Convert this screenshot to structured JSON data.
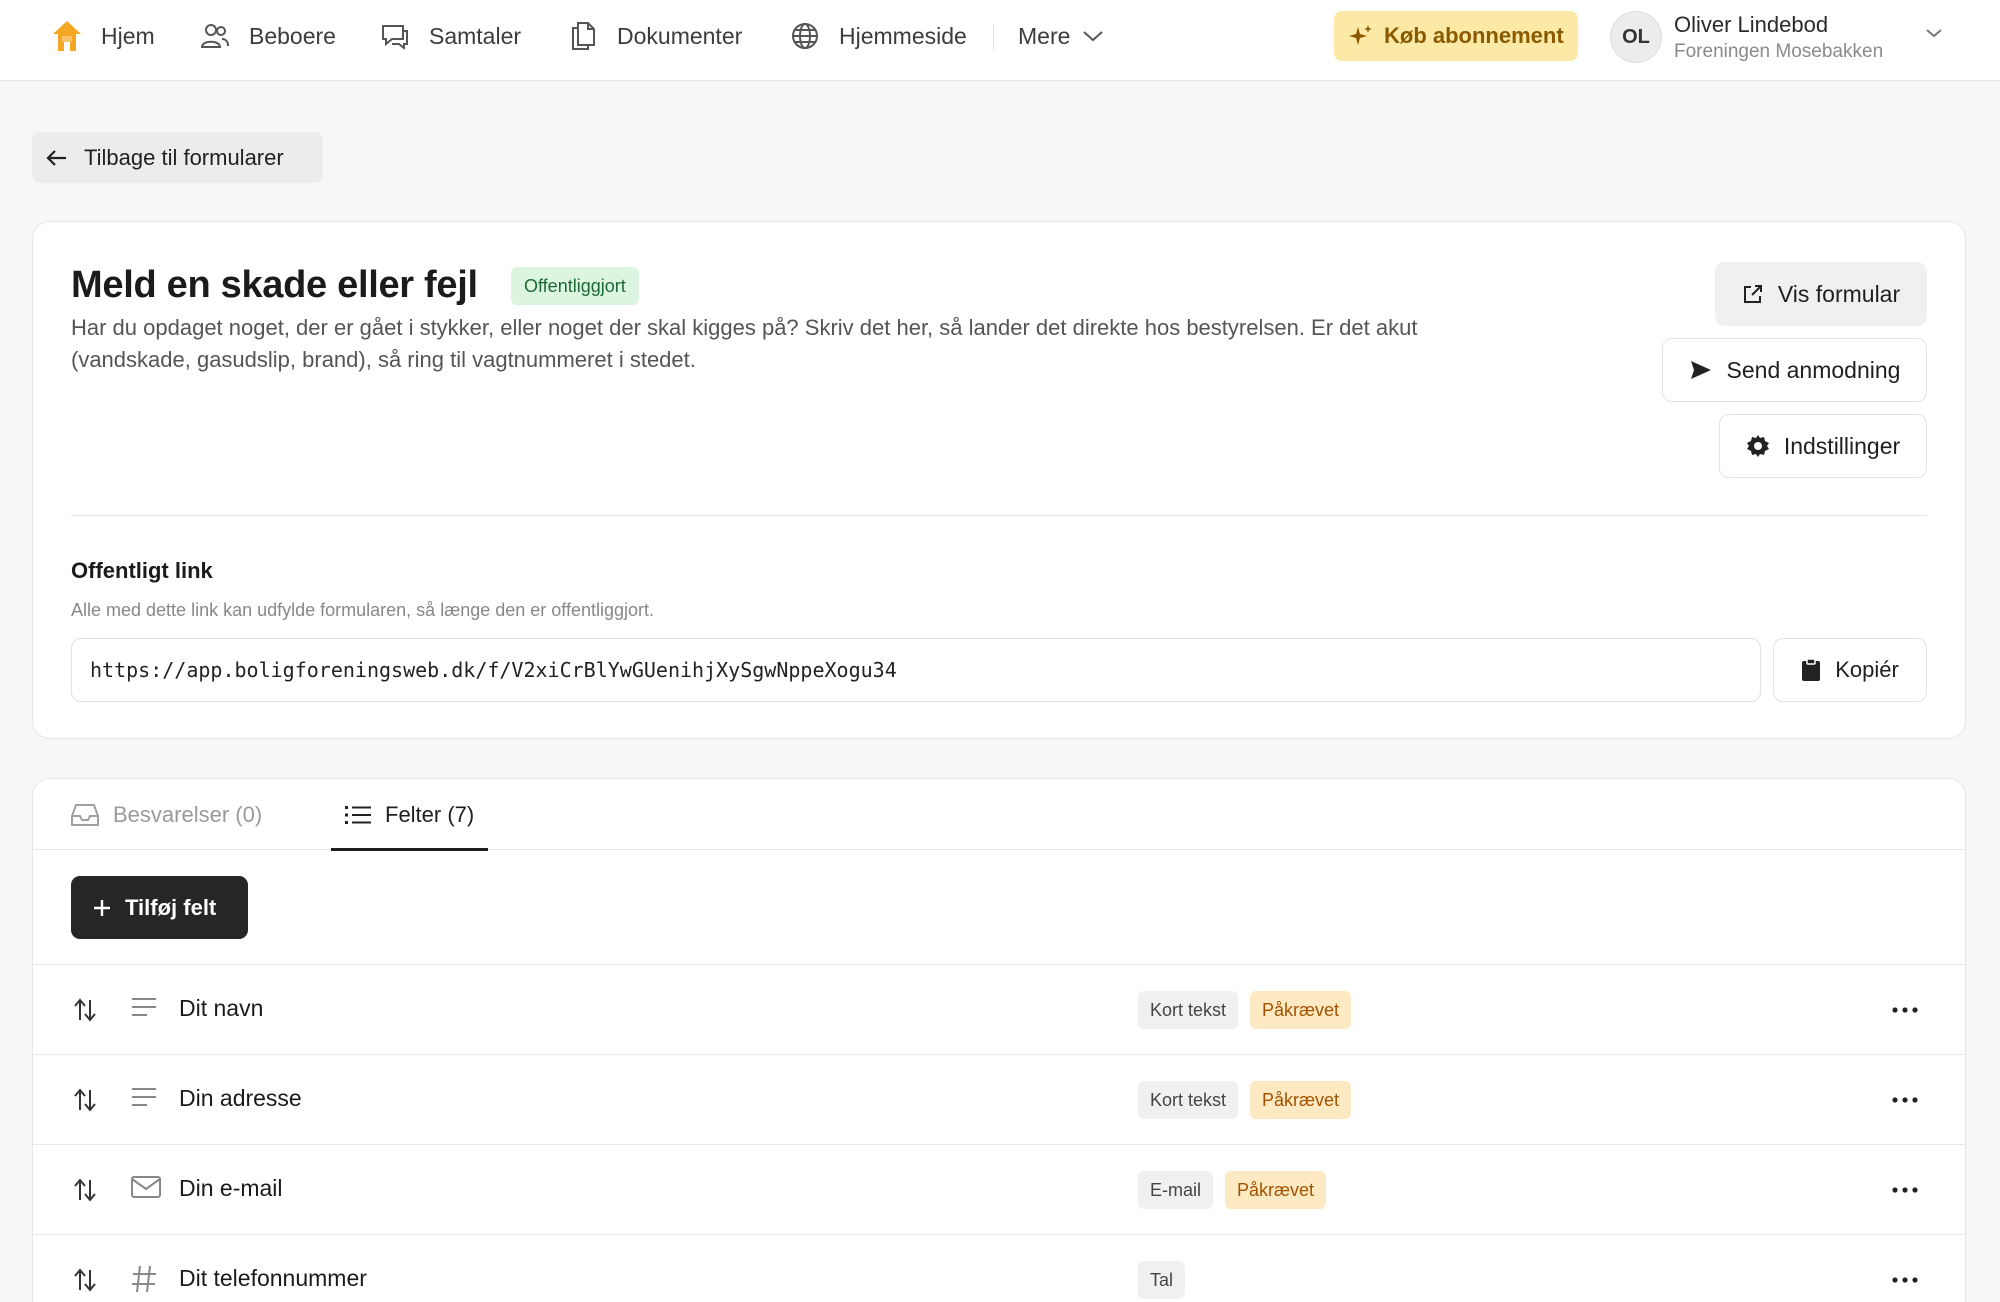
{
  "nav": {
    "items": [
      {
        "label": "Hjem",
        "icon": "home-icon"
      },
      {
        "label": "Beboere",
        "icon": "users-icon"
      },
      {
        "label": "Samtaler",
        "icon": "chat-icon"
      },
      {
        "label": "Dokumenter",
        "icon": "documents-icon"
      },
      {
        "label": "Hjemmeside",
        "icon": "globe-icon"
      }
    ],
    "more_label": "Mere",
    "buy_label": "Køb abonnement"
  },
  "user": {
    "initials": "OL",
    "name": "Oliver Lindebod",
    "org": "Foreningen Mosebakken"
  },
  "back_label": "Tilbage til formularer",
  "form": {
    "title": "Meld en skade eller fejl",
    "status": "Offentliggjort",
    "description": "Har du opdaget noget, der er gået i stykker, eller noget der skal kigges på? Skriv det her, så lander det direkte hos bestyrelsen. Er det akut (vandskade, gasudslip, brand), så ring til vagtnummeret i stedet.",
    "actions": {
      "view": "Vis formular",
      "send": "Send anmodning",
      "settings": "Indstillinger"
    }
  },
  "public_link": {
    "label": "Offentligt link",
    "help": "Alle med dette link kan udfylde formularen, så længe den er offentliggjort.",
    "url": "https://app.boligforeningsweb.dk/f/V2xiCrBlYwGUenihjXySgwNppeXogu34",
    "copy_label": "Kopiér"
  },
  "tabs": {
    "responses": "Besvarelser (0)",
    "fields": "Felter (7)"
  },
  "add_field_label": "Tilføj felt",
  "fields": [
    {
      "label": "Dit navn",
      "type": "Kort tekst",
      "required": "Påkrævet",
      "icon": "text-lines-icon"
    },
    {
      "label": "Din adresse",
      "type": "Kort tekst",
      "required": "Påkrævet",
      "icon": "text-lines-icon"
    },
    {
      "label": "Din e-mail",
      "type": "E-mail",
      "required": "Påkrævet",
      "icon": "mail-icon"
    },
    {
      "label": "Dit telefonnummer",
      "type": "Tal",
      "required": "",
      "icon": "hash-icon"
    }
  ],
  "colors": {
    "accent_orange": "#f5a623",
    "published_green": "#dcf5e1",
    "required_bg": "#fde9c2",
    "primary_dark": "#262626"
  }
}
